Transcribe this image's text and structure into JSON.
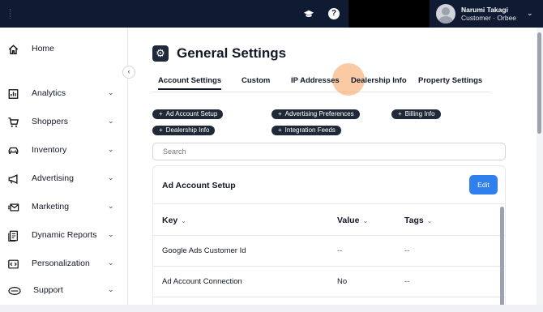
{
  "topbar": {
    "user_name": "Narumi Takagi",
    "user_org": "Customer · Orbee"
  },
  "sidebar": {
    "items": [
      {
        "label": "Home",
        "icon": "home-icon",
        "has_chevron": false
      },
      {
        "label": "Analytics",
        "icon": "analytics-icon",
        "has_chevron": true
      },
      {
        "label": "Shoppers",
        "icon": "cart-icon",
        "has_chevron": true
      },
      {
        "label": "Inventory",
        "icon": "car-icon",
        "has_chevron": true
      },
      {
        "label": "Advertising",
        "icon": "megaphone-icon",
        "has_chevron": true
      },
      {
        "label": "Marketing",
        "icon": "mail-icon",
        "has_chevron": true
      },
      {
        "label": "Dynamic Reports",
        "icon": "report-icon",
        "has_chevron": true
      },
      {
        "label": "Personalization",
        "icon": "code-icon",
        "has_chevron": true
      },
      {
        "label": "Support",
        "icon": "support-icon",
        "has_chevron": true
      }
    ]
  },
  "main": {
    "title": "General Settings",
    "tabs": [
      {
        "label": "Account Settings",
        "active": true
      },
      {
        "label": "Custom",
        "active": false
      },
      {
        "label": "IP Addresses",
        "active": false
      },
      {
        "label": "Dealership Info",
        "active": false
      },
      {
        "label": "Property Settings",
        "active": false
      }
    ],
    "pills": [
      {
        "label": "Ad Account Setup"
      },
      {
        "label": "Advertising Preferences"
      },
      {
        "label": "Billing Info"
      },
      {
        "label": "Dealership Info"
      },
      {
        "label": "Integration Feeds"
      }
    ],
    "search_placeholder": "Search",
    "card": {
      "title": "Ad Account Setup",
      "edit_label": "Edit",
      "columns": [
        "Key",
        "Value",
        "Tags"
      ],
      "rows": [
        {
          "key": "Google Ads Customer Id",
          "value": "--",
          "tags": "--"
        },
        {
          "key": "Ad Account Connection",
          "value": "No",
          "tags": "--"
        }
      ]
    }
  },
  "colors": {
    "topbar": "#0f1b33",
    "accent_button": "#2f80ed",
    "pill": "#1f2937",
    "click_highlight": "#f59e5a"
  }
}
